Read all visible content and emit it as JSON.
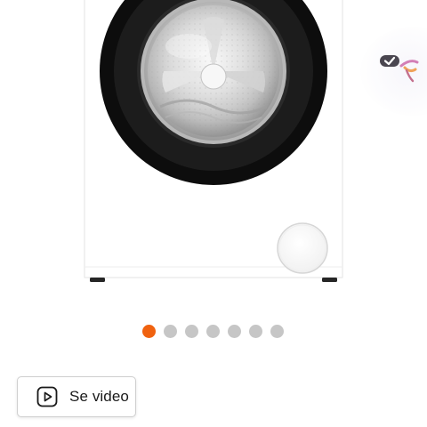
{
  "product": {
    "image_alt": "",
    "badge_icon": "checkmark-badge-icon"
  },
  "gallery": {
    "total_images": 7,
    "active_index": 0,
    "colors": {
      "active": "#f0620f",
      "inactive": "#c6c6c6"
    }
  },
  "video_button": {
    "label": "Se video",
    "icon": "play-icon"
  }
}
